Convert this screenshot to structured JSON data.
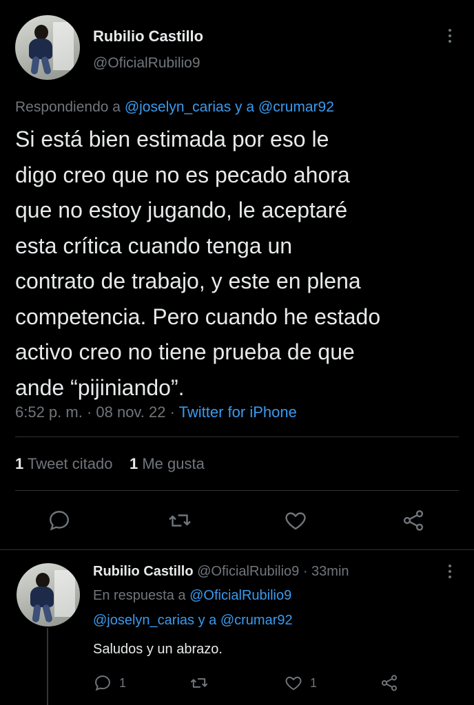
{
  "tweet": {
    "author_name": "Rubilio Castillo",
    "author_handle": "@OficialRubilio9",
    "replying_prefix": "Respondiendo a",
    "replying_to": "@joselyn_carias y a @crumar92",
    "text_lines": [
      "Si está bien estimada por eso le",
      "digo creo que no es pecado ahora",
      "que no estoy jugando, le aceptaré",
      "esta crítica cuando tenga un",
      "contrato de trabajo, y este en plena",
      "competencia. Pero cuando he estado",
      "activo creo no tiene prueba de que",
      "ande “pijiniando”."
    ],
    "time": "6:52 p. m. · 08 nov. 22 ·",
    "source": "Twitter for iPhone",
    "quote_count": "1",
    "quote_label": "Tweet citado",
    "like_count": "1",
    "like_label": "Me gusta"
  },
  "reply": {
    "author_name": "Rubilio Castillo",
    "author_handle": "@OficialRubilio9 · 33min",
    "in_reply_prefix": "En respuesta a",
    "in_reply_to": "@OficialRubilio9",
    "in_reply_line2": "@joselyn_carias y a @crumar92",
    "text": "Saludos y un abrazo.",
    "reply_count": "1",
    "like_count": "1"
  },
  "colors": {
    "accent": "#3a9bf0",
    "muted": "#71767b",
    "text": "#e7e9ea",
    "background": "#000000"
  },
  "icons": [
    "more-icon",
    "reply-icon",
    "retweet-icon",
    "like-icon",
    "share-icon"
  ]
}
